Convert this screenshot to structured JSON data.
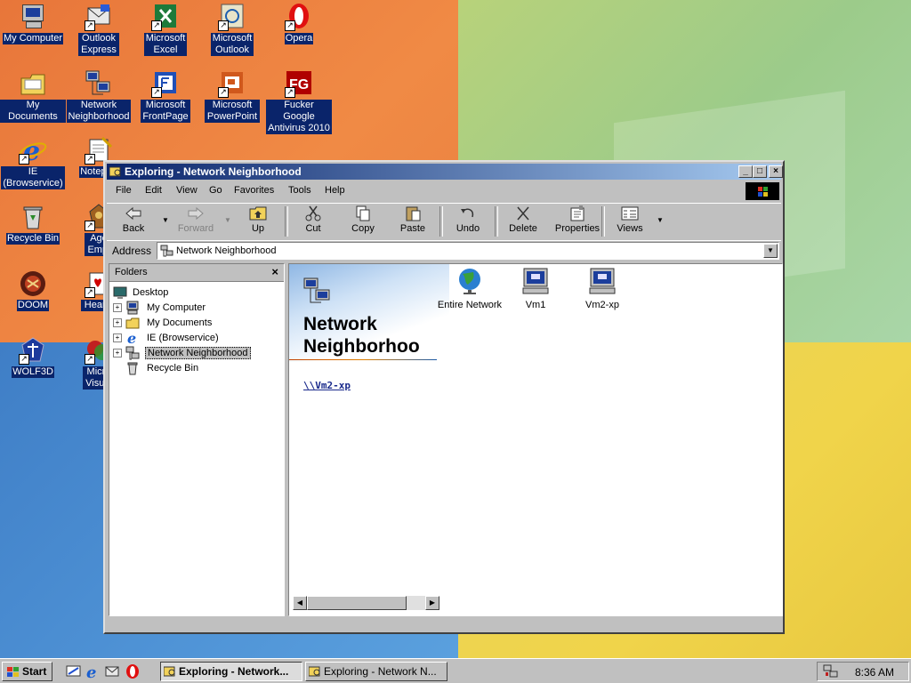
{
  "desktop": {
    "icons": [
      {
        "label": "My Computer",
        "icon": "my-computer-icon"
      },
      {
        "label": "Outlook Express",
        "icon": "outlook-express-icon"
      },
      {
        "label": "Microsoft Excel",
        "icon": "excel-icon"
      },
      {
        "label": "Microsoft Outlook",
        "icon": "outlook-icon"
      },
      {
        "label": "Opera",
        "icon": "opera-icon"
      },
      {
        "label": "My Documents",
        "icon": "my-documents-icon"
      },
      {
        "label": "Network Neighborhood",
        "icon": "network-neighborhood-icon"
      },
      {
        "label": "Microsoft FrontPage",
        "icon": "frontpage-icon"
      },
      {
        "label": "Microsoft PowerPoint",
        "icon": "powerpoint-icon"
      },
      {
        "label": "Fucker Google Antivirus 2010",
        "icon": "antivirus-icon"
      },
      {
        "label": "IE (Browservice)",
        "icon": "ie-icon"
      },
      {
        "label": "Notepad",
        "icon": "notepad-icon"
      },
      {
        "label": "Recycle Bin",
        "icon": "recycle-bin-icon"
      },
      {
        "label": "Age Empi",
        "icon": "age-of-empires-icon"
      },
      {
        "label": "DOOM",
        "icon": "doom-icon"
      },
      {
        "label": "Hearts",
        "icon": "hearts-icon"
      },
      {
        "label": "WOLF3D",
        "icon": "wolf3d-icon"
      },
      {
        "label": "Micro Visual",
        "icon": "visual-studio-icon"
      }
    ]
  },
  "window": {
    "title": "Exploring - Network Neighborhood",
    "menu": [
      "File",
      "Edit",
      "View",
      "Go",
      "Favorites",
      "Tools",
      "Help"
    ],
    "toolbar": {
      "back": "Back",
      "forward": "Forward",
      "up": "Up",
      "cut": "Cut",
      "copy": "Copy",
      "paste": "Paste",
      "undo": "Undo",
      "delete": "Delete",
      "properties": "Properties",
      "views": "Views"
    },
    "address": {
      "label": "Address",
      "value": "Network Neighborhood"
    },
    "folders": {
      "title": "Folders",
      "close": "×",
      "items": [
        {
          "label": "Desktop",
          "icon": "desktop-icon"
        },
        {
          "label": "My Computer",
          "icon": "my-computer-icon"
        },
        {
          "label": "My Documents",
          "icon": "my-documents-icon"
        },
        {
          "label": "IE (Browservice)",
          "icon": "ie-icon"
        },
        {
          "label": "Network Neighborhood",
          "icon": "network-neighborhood-icon"
        },
        {
          "label": "Recycle Bin",
          "icon": "recycle-bin-icon"
        }
      ]
    },
    "content": {
      "heading_line1": "Network",
      "heading_line2": "Neighborhoo",
      "link": "\\\\Vm2-xp",
      "items": [
        {
          "label": "Entire Network",
          "icon": "globe-icon"
        },
        {
          "label": "Vm1",
          "icon": "computer-icon"
        },
        {
          "label": "Vm2-xp",
          "icon": "computer-icon"
        }
      ]
    }
  },
  "taskbar": {
    "start": "Start",
    "tasks": [
      {
        "label": "Exploring - Network...",
        "active": true
      },
      {
        "label": "Exploring - Network N...",
        "active": false
      }
    ],
    "clock": "8:36 AM"
  },
  "colors": {
    "title_active": "#0a246a",
    "face": "#c0c0c0",
    "selection": "#0a246a"
  }
}
